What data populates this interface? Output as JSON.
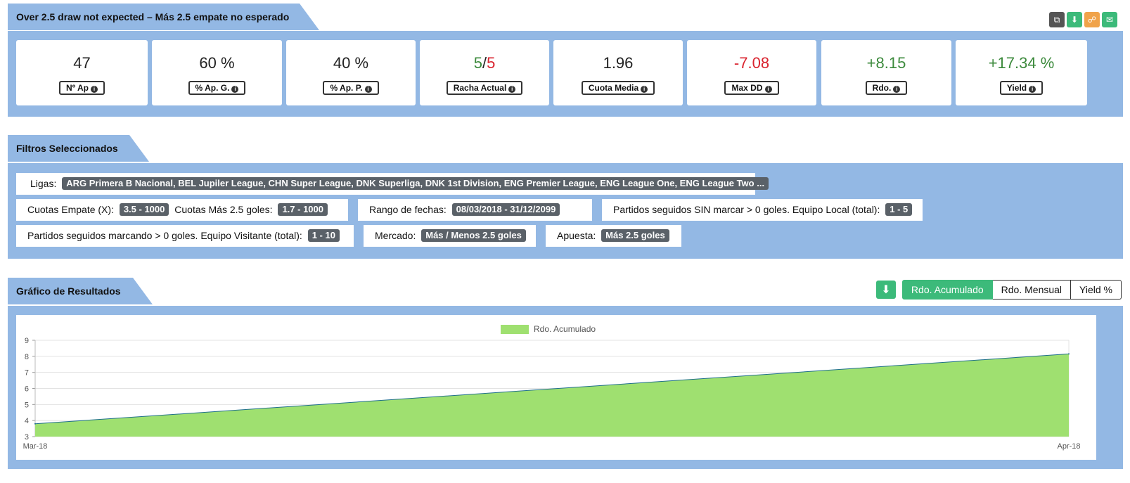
{
  "system": {
    "title": "Over 2.5 draw not expected – Más 2.5 empate no esperado",
    "icons": [
      "copy-icon",
      "download-icon",
      "share-icon",
      "mail-icon"
    ],
    "icon_colors": [
      "#555555",
      "#3cba7a",
      "#f0a34a",
      "#3cba7a"
    ]
  },
  "stats": [
    {
      "value": "47",
      "label": "Nº Ap"
    },
    {
      "value": "60 %",
      "label": "% Ap. G."
    },
    {
      "value": "40 %",
      "label": "% Ap. P."
    },
    {
      "value_a": "5",
      "value_sep": "/",
      "value_b": "5",
      "label": "Racha Actual"
    },
    {
      "value": "1.96",
      "label": "Cuota Media"
    },
    {
      "value": "-7.08",
      "label": "Max DD"
    },
    {
      "value": "+8.15",
      "label": "Rdo."
    },
    {
      "value": "+17.34 %",
      "label": "Yield"
    }
  ],
  "filters": {
    "title": "Filtros Seleccionados",
    "ligas_label": "Ligas:",
    "ligas_value": "ARG Primera B Nacional, BEL Jupiler League, CHN Super League, DNK Superliga, DNK 1st Division, ENG Premier League, ENG League One, ENG League Two ...",
    "empate_label": "Cuotas Empate (X):",
    "empate_value": "3.5 - 1000",
    "mas25_label": "Cuotas Más 2.5 goles:",
    "mas25_value": "1.7 - 1000",
    "fechas_label": "Rango de fechas:",
    "fechas_value": "08/03/2018 - 31/12/2099",
    "sin_marcar_label": "Partidos seguidos SIN marcar > 0 goles. Equipo Local (total):",
    "sin_marcar_value": "1 - 5",
    "marcando_label": "Partidos seguidos marcando > 0 goles. Equipo Visitante (total):",
    "marcando_value": "1 - 10",
    "mercado_label": "Mercado:",
    "mercado_value": "Más / Menos 2.5 goles",
    "apuesta_label": "Apuesta:",
    "apuesta_value": "Más 2.5 goles"
  },
  "chart_section": {
    "title": "Gráfico de Resultados",
    "tabs": [
      "Rdo. Acumulado",
      "Rdo. Mensual",
      "Yield %"
    ],
    "active_tab": "Rdo. Acumulado"
  },
  "chart_data": {
    "type": "area",
    "x": [
      "Mar-18",
      "Apr-18"
    ],
    "series": [
      {
        "name": "Rdo. Acumulado",
        "values": [
          3.8,
          8.15
        ],
        "color": "#9fe070",
        "line_color": "#1f6f8b"
      }
    ],
    "ylim": [
      3,
      9
    ],
    "yticks": [
      3,
      4,
      5,
      6,
      7,
      8,
      9
    ],
    "legend_position": "top-center",
    "grid": true
  }
}
